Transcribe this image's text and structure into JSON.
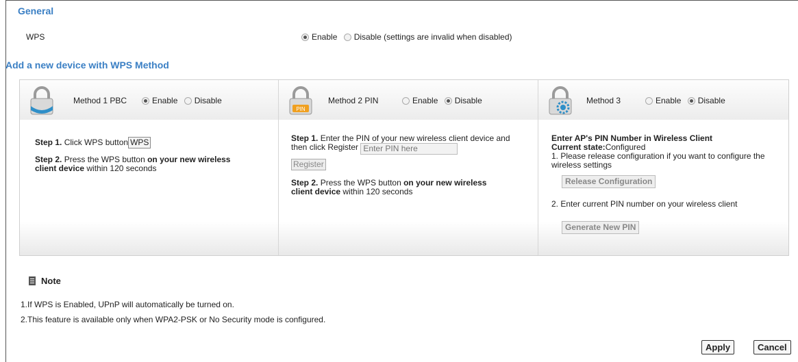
{
  "general": {
    "title": "General",
    "wps_label": "WPS",
    "wps_enable": "Enable",
    "wps_disable": "Disable (settings are invalid when disabled)"
  },
  "add_device": {
    "title": "Add a new device with WPS Method"
  },
  "methods": [
    {
      "label": "Method 1 PBC",
      "enable": "Enable",
      "disable": "Disable",
      "step1_prefix": "Step 1.",
      "step1_text": " Click WPS button",
      "wps_button": "WPS",
      "step2_prefix": "Step 2.",
      "step2_text1": " Press the WPS button ",
      "step2_bold": "on your new wireless client device",
      "step2_text2": " within 120 seconds"
    },
    {
      "label": "Method 2 PIN",
      "enable": "Enable",
      "disable": "Disable",
      "step1_prefix": "Step 1.",
      "step1_text": " Enter the PIN of your new wireless client device and then click Register",
      "pin_placeholder": "Enter PIN here",
      "register_button": "Register",
      "step2_prefix": "Step 2.",
      "step2_text1": " Press the WPS button ",
      "step2_bold": "on your new wireless client device",
      "step2_text2": " within 120 seconds"
    },
    {
      "label": "Method 3",
      "enable": "Enable",
      "disable": "Disable",
      "heading": "Enter AP's PIN Number in Wireless Client",
      "state_label": "Current state:",
      "state_value": "Configured",
      "item1": "1. Please release configuration if you want to configure the wireless settings",
      "release_button": "Release Configuration",
      "item2": "2. Enter current PIN number  on your wireless client",
      "generate_button": "Generate New PIN"
    }
  ],
  "note": {
    "title": "Note",
    "line1": "1.If WPS is Enabled, UPnP will automatically be turned on.",
    "line2": "2.This feature is available only when WPA2-PSK or No Security mode is configured."
  },
  "actions": {
    "apply": "Apply",
    "cancel": "Cancel"
  },
  "colors": {
    "section_title": "#3a7fc4",
    "lock_blue": "#2f8fc8",
    "pin_orange": "#f0a020"
  },
  "state": {
    "wps": "enable",
    "method1": "enable",
    "method2": "disable",
    "method3": "disable"
  }
}
